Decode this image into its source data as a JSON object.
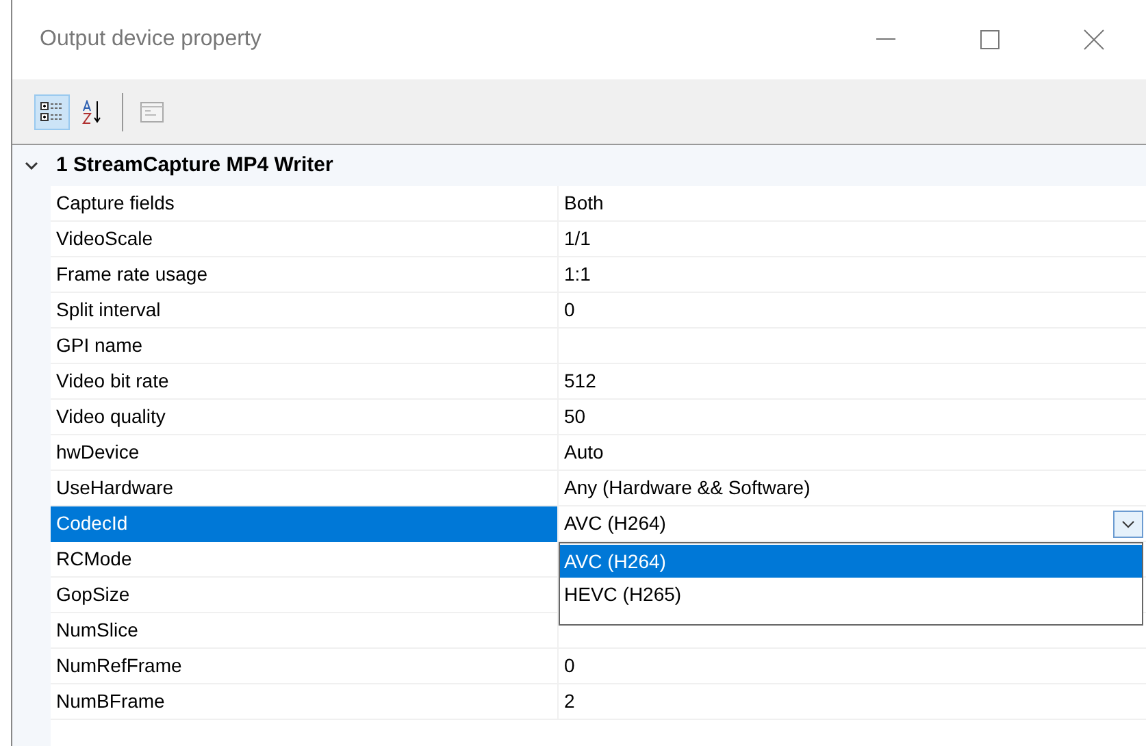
{
  "window": {
    "title": "Output device property"
  },
  "toolbar": [
    {
      "kind": "categorized",
      "selected": true
    },
    {
      "kind": "alphabetical",
      "selected": false
    },
    {
      "kind": "pages",
      "selected": false
    }
  ],
  "category": {
    "title": "1 StreamCapture MP4 Writer",
    "expanded": true
  },
  "properties": [
    {
      "name": "Capture fields",
      "value": "Both",
      "selected": false
    },
    {
      "name": "VideoScale",
      "value": "1/1",
      "selected": false
    },
    {
      "name": "Frame rate usage",
      "value": "1:1",
      "selected": false
    },
    {
      "name": "Split interval",
      "value": "0",
      "selected": false
    },
    {
      "name": "GPI name",
      "selected": false
    },
    {
      "name": "Video bit rate",
      "value": "512",
      "selected": false
    },
    {
      "name": "Video quality",
      "value": "50",
      "selected": false
    },
    {
      "name": "hwDevice",
      "value": "Auto",
      "selected": false
    },
    {
      "name": "UseHardware",
      "value": "Any (Hardware && Software)",
      "selected": false
    },
    {
      "name": "CodecId",
      "value": "AVC (H264)",
      "selected": true,
      "dropdown": {
        "open": true,
        "options": [
          {
            "label": "AVC (H264)",
            "selected": true
          },
          {
            "label": "HEVC (H265)",
            "selected": false
          }
        ]
      }
    },
    {
      "name": "RCMode",
      "selected": false
    },
    {
      "name": "GopSize",
      "selected": false
    },
    {
      "name": "NumSlice",
      "selected": false
    },
    {
      "name": "NumRefFrame",
      "value": "0",
      "selected": false
    },
    {
      "name": "NumBFrame",
      "value": "2",
      "selected": false
    }
  ]
}
